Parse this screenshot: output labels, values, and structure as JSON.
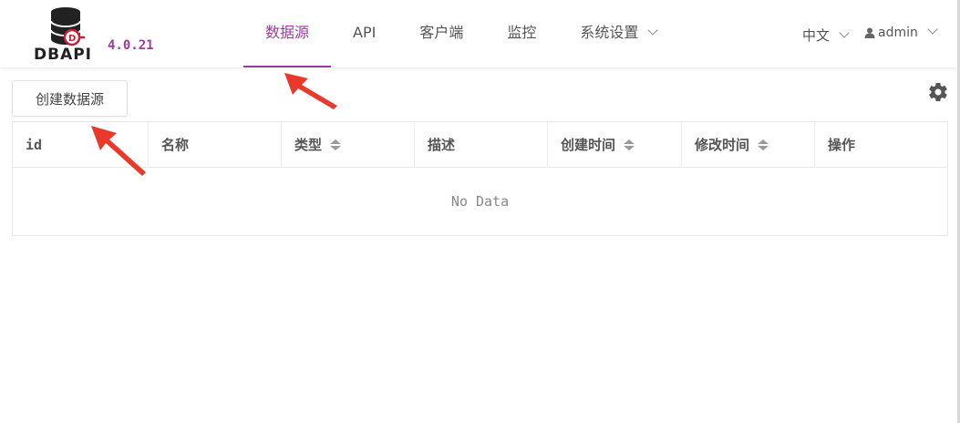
{
  "brand": {
    "logo_text": "DBAPI",
    "version": "4.0.21",
    "accent_color": "#9b3aa0"
  },
  "nav": {
    "items": [
      {
        "label": "数据源",
        "active": true
      },
      {
        "label": "API",
        "active": false
      },
      {
        "label": "客户端",
        "active": false
      },
      {
        "label": "监控",
        "active": false
      },
      {
        "label": "系统设置",
        "active": false,
        "dropdown": true
      }
    ]
  },
  "header_right": {
    "language": "中文",
    "username": "admin"
  },
  "toolbar": {
    "create_button_label": "创建数据源",
    "settings_icon": "gear-icon"
  },
  "table": {
    "columns": [
      {
        "label": "id",
        "sortable": false
      },
      {
        "label": "名称",
        "sortable": false
      },
      {
        "label": "类型",
        "sortable": true
      },
      {
        "label": "描述",
        "sortable": false
      },
      {
        "label": "创建时间",
        "sortable": true
      },
      {
        "label": "修改时间",
        "sortable": true
      },
      {
        "label": "操作",
        "sortable": false
      }
    ],
    "rows": [],
    "empty_text": "No Data"
  },
  "annotations": {
    "arrow_color": "#e8392b"
  }
}
